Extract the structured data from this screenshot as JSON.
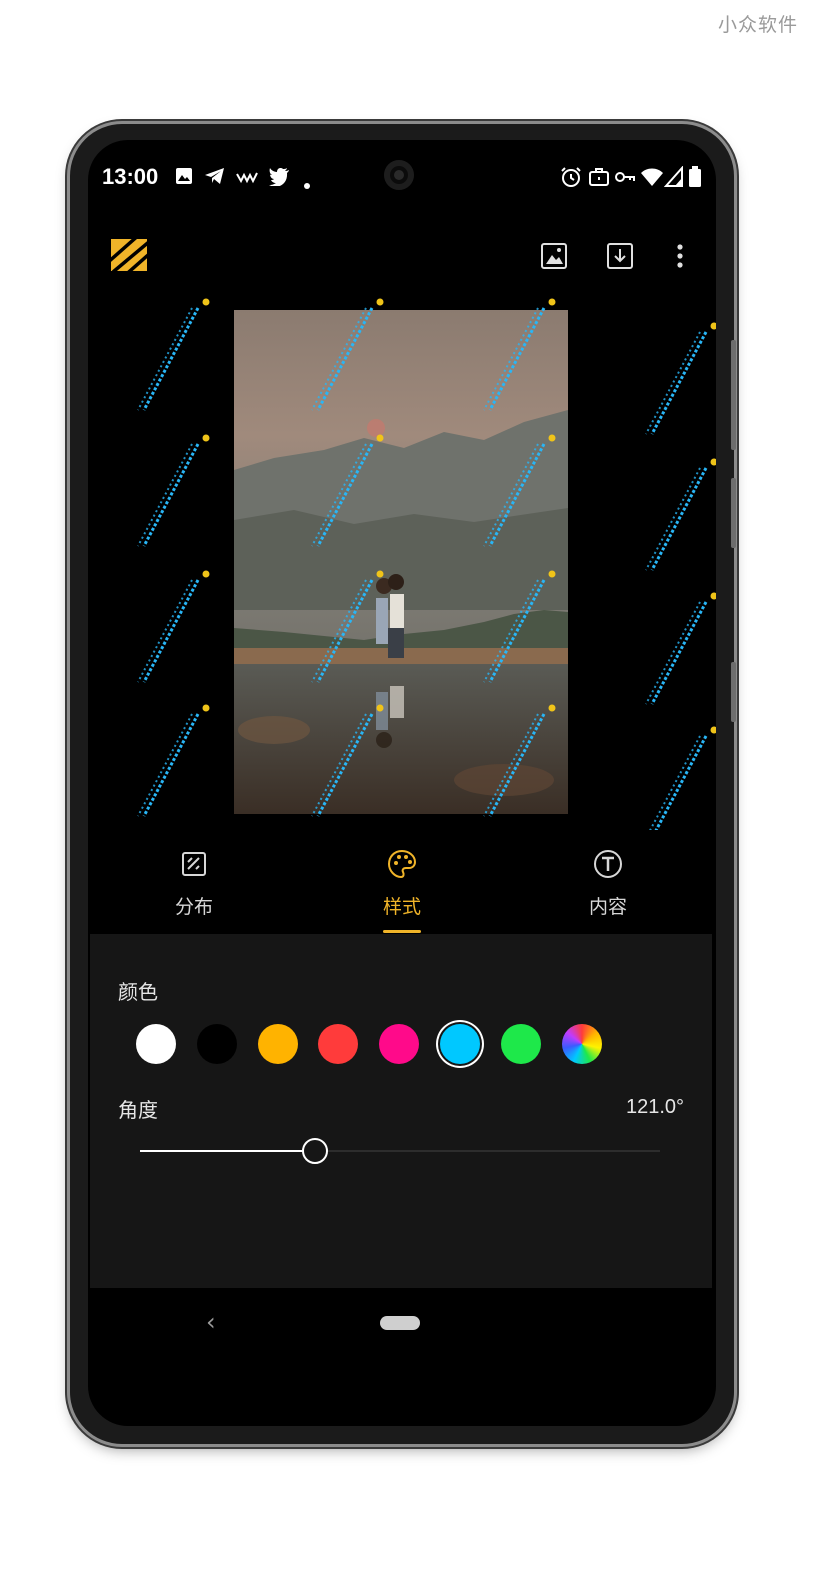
{
  "watermark_brand": "小众软件",
  "status_bar": {
    "time": "13:00",
    "left_icons": [
      "image-icon",
      "telegram-icon",
      "wave-icon",
      "twitter-icon",
      "dot-icon"
    ],
    "right_icons": [
      "alarm-icon",
      "briefcase-icon",
      "vpn-key-icon",
      "wifi-icon",
      "signal-icon",
      "battery-icon"
    ]
  },
  "app_bar": {
    "logo": "stripes-logo",
    "actions": [
      "image-icon",
      "download-icon",
      "more-vert-icon"
    ]
  },
  "tabs": [
    {
      "label": "分布",
      "icon": "grid-dots-icon",
      "active": false
    },
    {
      "label": "样式",
      "icon": "palette-icon",
      "active": true
    },
    {
      "label": "内容",
      "icon": "text-icon",
      "active": false
    }
  ],
  "style_panel": {
    "color_label": "颜色",
    "colors": [
      "#ffffff",
      "#000000",
      "#ffb300",
      "#ff3b3b",
      "#ff0a8a",
      "#00c8ff",
      "#1ee84a",
      "rainbow"
    ],
    "selected_color_index": 5,
    "angle_label": "角度",
    "angle_value": "121.0°",
    "angle_slider_fraction": 0.336
  },
  "accent_color": "#f0b429"
}
